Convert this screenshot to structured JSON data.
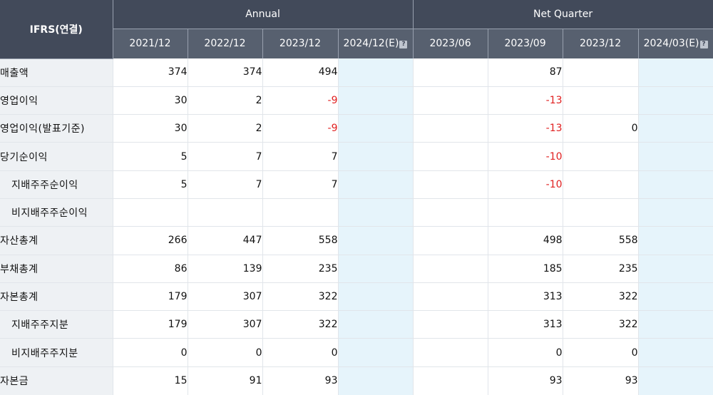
{
  "header": {
    "ifrs_label": "IFRS(연결)",
    "annual_label": "Annual",
    "quarter_label": "Net Quarter",
    "info_icon": "question-icon",
    "annual_columns": [
      "2021/12",
      "2022/12",
      "2023/12",
      "2024/12(E)"
    ],
    "quarter_columns": [
      "2023/06",
      "2023/09",
      "2023/12",
      "2024/03(E)"
    ]
  },
  "rows": [
    {
      "label": "매출액",
      "values": [
        "374",
        "374",
        "494",
        "",
        "",
        "87",
        "",
        ""
      ]
    },
    {
      "label": "영업이익",
      "values": [
        "30",
        "2",
        "-9",
        "",
        "",
        "-13",
        "",
        ""
      ]
    },
    {
      "label": "영업이익(발표기준)",
      "values": [
        "30",
        "2",
        "-9",
        "",
        "",
        "-13",
        "0",
        ""
      ]
    },
    {
      "label": "당기순이익",
      "values": [
        "5",
        "7",
        "7",
        "",
        "",
        "-10",
        "",
        ""
      ]
    },
    {
      "label": "지배주주순이익",
      "values": [
        "5",
        "7",
        "7",
        "",
        "",
        "-10",
        "",
        ""
      ]
    },
    {
      "label": "비지배주주순이익",
      "values": [
        "",
        "",
        "",
        "",
        "",
        "",
        "",
        ""
      ]
    },
    {
      "label": "자산총계",
      "values": [
        "266",
        "447",
        "558",
        "",
        "",
        "498",
        "558",
        ""
      ]
    },
    {
      "label": "부채총계",
      "values": [
        "86",
        "139",
        "235",
        "",
        "",
        "185",
        "235",
        ""
      ]
    },
    {
      "label": "자본총계",
      "values": [
        "179",
        "307",
        "322",
        "",
        "",
        "313",
        "322",
        ""
      ]
    },
    {
      "label": "지배주주지분",
      "values": [
        "179",
        "307",
        "322",
        "",
        "",
        "313",
        "322",
        ""
      ]
    },
    {
      "label": "비지배주주지분",
      "values": [
        "0",
        "0",
        "0",
        "",
        "",
        "0",
        "0",
        ""
      ]
    },
    {
      "label": "자본금",
      "values": [
        "15",
        "91",
        "93",
        "",
        "",
        "93",
        "93",
        ""
      ]
    }
  ],
  "colors": {
    "header_dark": "#424a5a",
    "header_sub": "#57606f",
    "label_bg": "#eef1f4",
    "estimate_bg": "#e6f4fb",
    "negative": "#e02020"
  }
}
